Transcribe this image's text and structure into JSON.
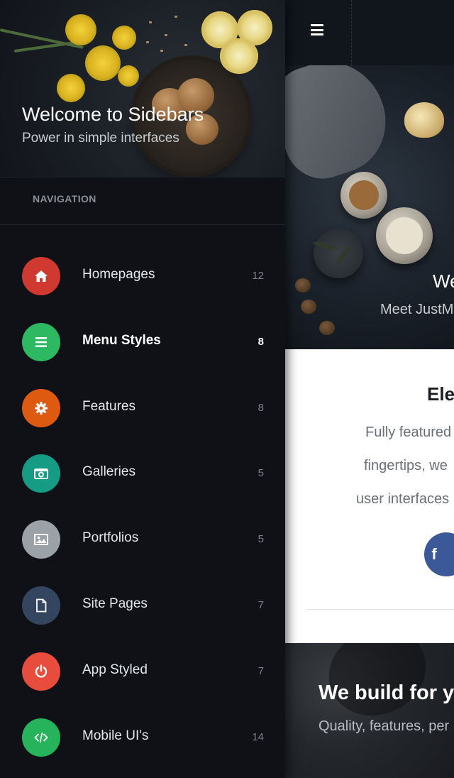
{
  "sidebar": {
    "header": {
      "title": "Welcome to Sidebars",
      "subtitle": "Power in simple interfaces"
    },
    "nav_heading": "NAVIGATION",
    "items": [
      {
        "label": "Homepages",
        "count": "12",
        "icon": "home-icon",
        "color": "#d0392f",
        "active": false
      },
      {
        "label": "Menu Styles",
        "count": "8",
        "icon": "menu-icon",
        "color": "#2db862",
        "active": true
      },
      {
        "label": "Features",
        "count": "8",
        "icon": "gear-icon",
        "color": "#dd5a10",
        "active": false
      },
      {
        "label": "Galleries",
        "count": "5",
        "icon": "camera-icon",
        "color": "#169c84",
        "active": false
      },
      {
        "label": "Portfolios",
        "count": "5",
        "icon": "image-icon",
        "color": "#9aa2a8",
        "active": false
      },
      {
        "label": "Site Pages",
        "count": "7",
        "icon": "file-icon",
        "color": "#34465f",
        "active": false
      },
      {
        "label": "App Styled",
        "count": "7",
        "icon": "power-icon",
        "color": "#e74c3c",
        "active": false
      },
      {
        "label": "Mobile UI's",
        "count": "14",
        "icon": "code-icon",
        "color": "#27b35c",
        "active": false
      }
    ]
  },
  "main": {
    "hero": {
      "title": "We",
      "subtitle": "Meet JustM"
    },
    "card": {
      "title": "Ele",
      "lines": [
        "Fully featured",
        "fingertips, we",
        "user interfaces"
      ],
      "social_letter": "f"
    },
    "footer": {
      "title": "We build for yo",
      "subtitle": "Quality, features, per"
    }
  },
  "colors": {
    "sidebar_bg": "#0f1117",
    "facebook": "#3b5998"
  }
}
